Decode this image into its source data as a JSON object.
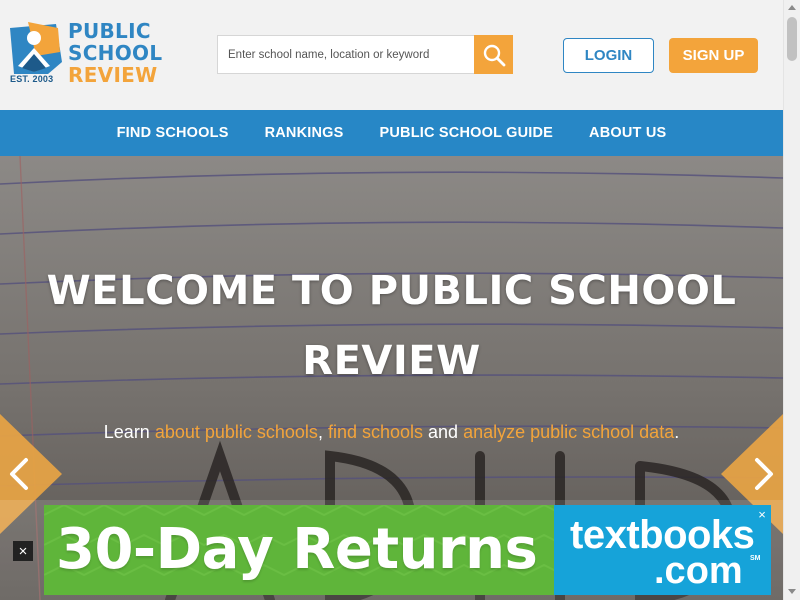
{
  "logo": {
    "line1": "PUBLIC",
    "line2": "SCHOOL",
    "line3": "REVIEW",
    "est": "EST. 2003"
  },
  "search": {
    "placeholder": "Enter school name, location or keyword",
    "value": ""
  },
  "auth": {
    "login_label": "LOGIN",
    "signup_label": "SIGN UP"
  },
  "nav": {
    "items": [
      {
        "label": "FIND SCHOOLS"
      },
      {
        "label": "RANKINGS"
      },
      {
        "label": "PUBLIC SCHOOL GUIDE"
      },
      {
        "label": "ABOUT US"
      }
    ]
  },
  "hero": {
    "title_line1": "WELCOME TO PUBLIC SCHOOL",
    "title_line2": "REVIEW",
    "sub_lead": "Learn ",
    "link1": "about public schools",
    "sep1": ", ",
    "link2": "find schools",
    "sep2": " and ",
    "link3": "analyze public school data",
    "sub_end": "."
  },
  "ad": {
    "headline": "30-Day Returns",
    "brand_line1": "textbooks",
    "brand_line2": ".com",
    "brand_mark": "SM",
    "close_glyph": "×",
    "dismiss_glyph": "×"
  },
  "colors": {
    "brand_blue": "#2787c6",
    "brand_orange": "#f3a43b",
    "ad_green": "#5fb53a",
    "ad_blue": "#16a3d9"
  },
  "icons": {
    "search": "search-icon",
    "prev": "chevron-left-icon",
    "next": "chevron-right-icon"
  }
}
